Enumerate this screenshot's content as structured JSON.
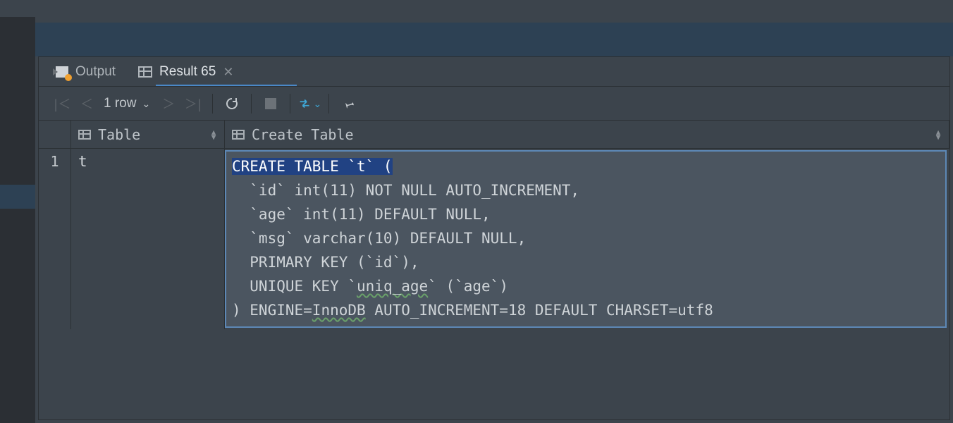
{
  "tabs": {
    "output_label": "Output",
    "result_label": "Result 65"
  },
  "toolbar": {
    "row_count_label": "1 row"
  },
  "columns": {
    "table_header": "Table",
    "create_header": "Create Table"
  },
  "rows": [
    {
      "num": "1",
      "table": "t",
      "create_sql": {
        "l1": "CREATE TABLE `t` (",
        "l2": "  `id` int(11) NOT NULL AUTO_INCREMENT,",
        "l3": "  `age` int(11) DEFAULT NULL,",
        "l4": "  `msg` varchar(10) DEFAULT NULL,",
        "l5": "  PRIMARY KEY (`id`),",
        "l6a": "  UNIQUE KEY `",
        "l6b": "uniq_age",
        "l6c": "` (`age`)",
        "l7a": ") ENGINE=",
        "l7b": "InnoDB",
        "l7c": " AUTO_INCREMENT=18 DEFAULT CHARSET=utf8"
      }
    }
  ]
}
